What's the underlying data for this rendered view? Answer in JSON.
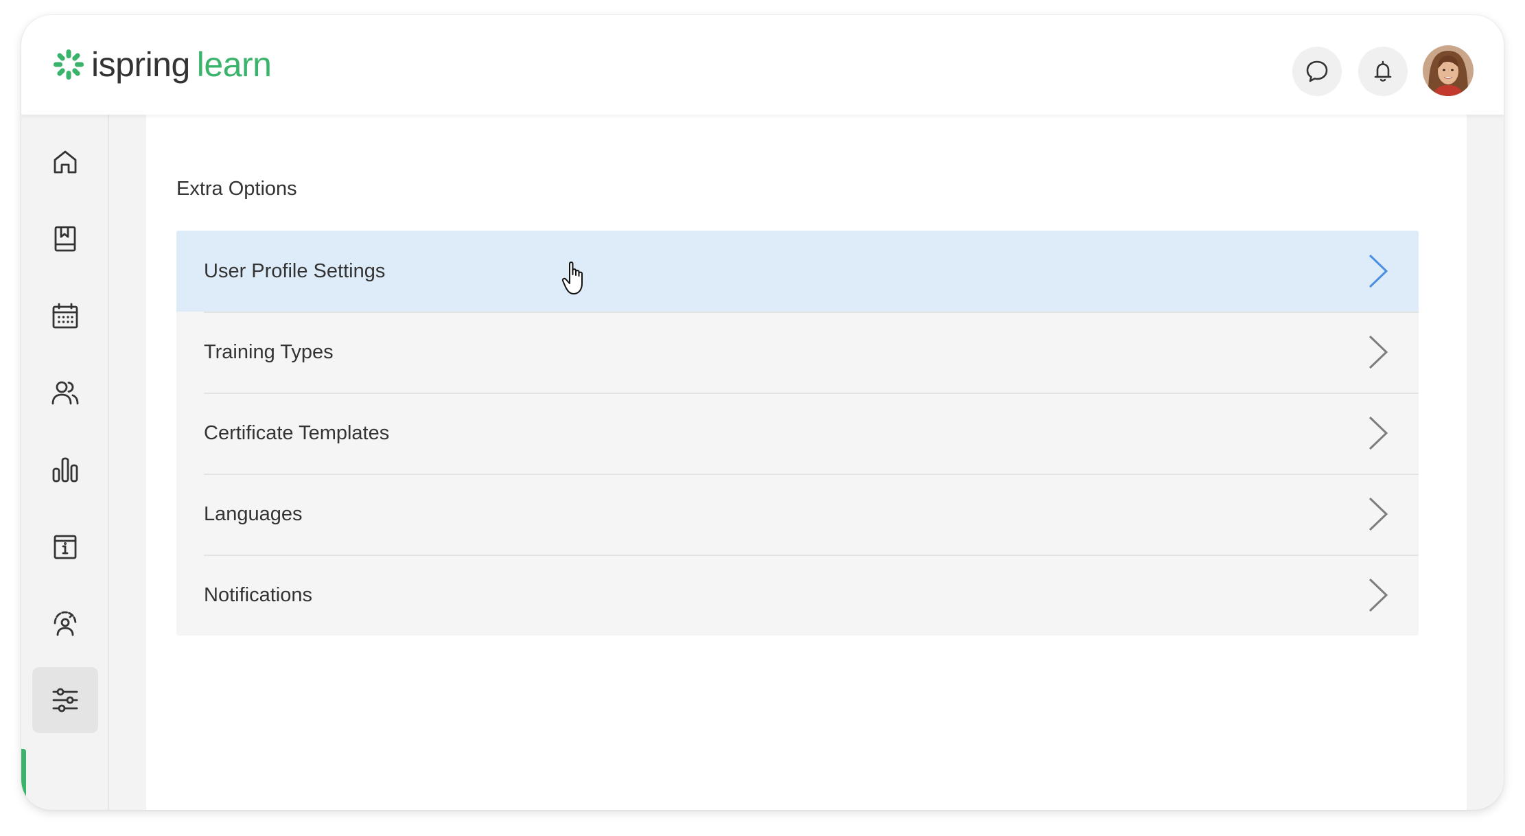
{
  "app": {
    "logo_text_1": "ispring",
    "logo_text_2": "learn",
    "brand_color": "#3ab36b",
    "accent_color": "#4a90e2"
  },
  "header": {
    "actions": [
      {
        "name": "chat",
        "icon": "chat-bubble-icon"
      },
      {
        "name": "notifications",
        "icon": "bell-icon"
      },
      {
        "name": "profile",
        "icon": "avatar"
      }
    ]
  },
  "sidebar": {
    "items": [
      {
        "id": "home",
        "icon": "home-icon"
      },
      {
        "id": "courses",
        "icon": "book-icon"
      },
      {
        "id": "calendar",
        "icon": "calendar-icon"
      },
      {
        "id": "users",
        "icon": "users-icon"
      },
      {
        "id": "reports",
        "icon": "bar-chart-icon"
      },
      {
        "id": "info",
        "icon": "info-page-icon"
      },
      {
        "id": "admin",
        "icon": "user-settings-icon"
      },
      {
        "id": "settings",
        "icon": "sliders-icon",
        "active": true
      }
    ]
  },
  "main": {
    "section_title": "Extra Options",
    "options": [
      {
        "label": "User Profile Settings",
        "state": "hover"
      },
      {
        "label": "Training Types"
      },
      {
        "label": "Certificate Templates"
      },
      {
        "label": "Languages"
      },
      {
        "label": "Notifications"
      }
    ]
  }
}
